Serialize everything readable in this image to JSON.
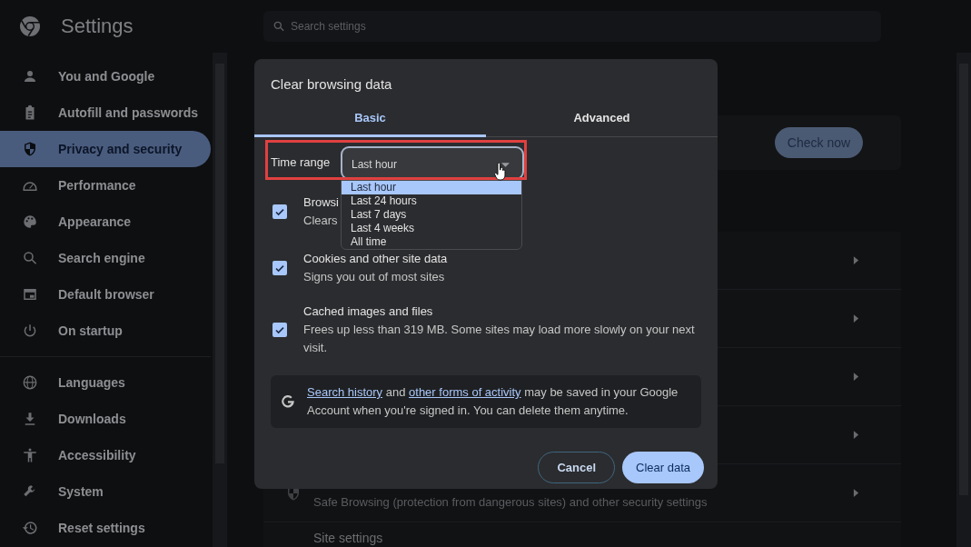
{
  "header": {
    "title": "Settings"
  },
  "search": {
    "placeholder": "Search settings"
  },
  "sidebar": {
    "groups": [
      {
        "items": [
          {
            "label": "You and Google",
            "selected": false
          },
          {
            "label": "Autofill and passwords",
            "selected": false
          },
          {
            "label": "Privacy and security",
            "selected": true
          },
          {
            "label": "Performance",
            "selected": false
          },
          {
            "label": "Appearance",
            "selected": false
          },
          {
            "label": "Search engine",
            "selected": false
          },
          {
            "label": "Default browser",
            "selected": false
          },
          {
            "label": "On startup",
            "selected": false
          }
        ]
      },
      {
        "items": [
          {
            "label": "Languages",
            "selected": false
          },
          {
            "label": "Downloads",
            "selected": false
          },
          {
            "label": "Accessibility",
            "selected": false
          },
          {
            "label": "System",
            "selected": false
          },
          {
            "label": "Reset settings",
            "selected": false
          }
        ]
      }
    ]
  },
  "main": {
    "check_button": "Check now",
    "rows": [
      {
        "kind": "link"
      },
      {
        "kind": "link"
      },
      {
        "kind": "link"
      },
      {
        "kind": "link"
      },
      {
        "kind": "shield_link",
        "subtitle": "Safe Browsing (protection from dangerous sites) and other security settings"
      },
      {
        "kind": "plain",
        "title": "Site settings"
      }
    ]
  },
  "dialog": {
    "title": "Clear browsing data",
    "tabs": [
      {
        "label": "Basic",
        "selected": true
      },
      {
        "label": "Advanced",
        "selected": false
      }
    ],
    "time_range": {
      "label": "Time range",
      "value": "Last hour",
      "highlighted": true,
      "options": [
        {
          "label": "Last hour",
          "selected": true
        },
        {
          "label": "Last 24 hours",
          "selected": false
        },
        {
          "label": "Last 7 days",
          "selected": false
        },
        {
          "label": "Last 4 weeks",
          "selected": false
        },
        {
          "label": "All time",
          "selected": false
        }
      ]
    },
    "checkboxes": [
      {
        "title": "Browsi",
        "subtitle": "Clears",
        "checked": true
      },
      {
        "title": "Cookies and other site data",
        "subtitle": "Signs you out of most sites",
        "checked": true
      },
      {
        "title": "Cached images and files",
        "subtitle": "Frees up less than 319 MB. Some sites may load more slowly on your next visit.",
        "checked": true
      }
    ],
    "info": {
      "segments": [
        {
          "text": "Search history",
          "link": true
        },
        {
          "text": "and",
          "link": false
        },
        {
          "text": "other forms of activity",
          "link": true
        },
        {
          "text": "may be saved in your Google Account when you're signed in. You can delete them anytime.",
          "link": false
        }
      ]
    },
    "buttons": [
      {
        "label": "Cancel",
        "kind": "outline"
      },
      {
        "label": "Clear data",
        "kind": "filled"
      }
    ]
  }
}
